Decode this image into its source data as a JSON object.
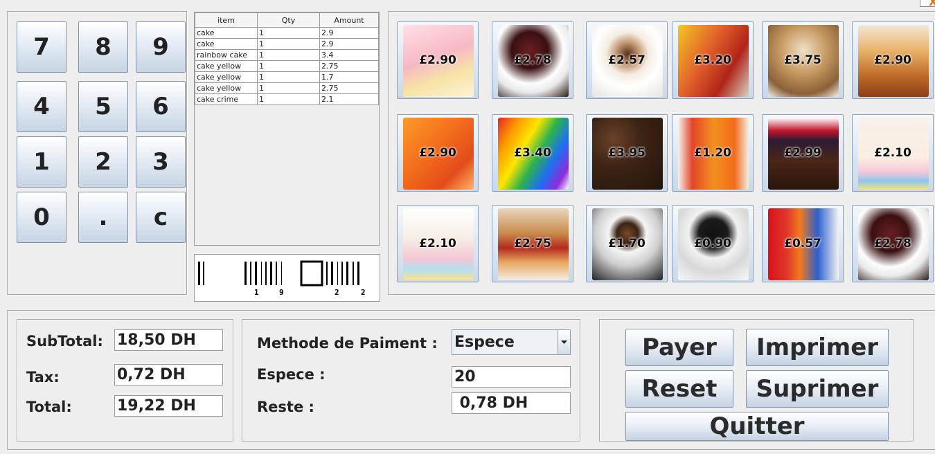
{
  "window": {
    "close_label": "X"
  },
  "keypad": {
    "keys": [
      "7",
      "8",
      "9",
      "4",
      "5",
      "6",
      "1",
      "2",
      "3",
      "0",
      ".",
      "c"
    ]
  },
  "order_table": {
    "headers": [
      "item",
      "Qty",
      "Amount"
    ],
    "rows": [
      [
        "cake",
        "1",
        "2.9"
      ],
      [
        "cake",
        "1",
        "2.9"
      ],
      [
        "rainbow cake",
        "1",
        "3.4"
      ],
      [
        "cake yellow",
        "1",
        "2.75"
      ],
      [
        "cake yellow",
        "1",
        "1.7"
      ],
      [
        "cake yellow",
        "1",
        "2.75"
      ],
      [
        "cake crime",
        "1",
        "2.1"
      ]
    ]
  },
  "barcode": {
    "digits": [
      "1",
      "9",
      "2",
      "2"
    ]
  },
  "products": [
    {
      "price": "£2.90",
      "icon": "strawberry-cake-slice"
    },
    {
      "price": "£2.78",
      "icon": "chocolate-cake"
    },
    {
      "price": "£2.57",
      "icon": "cappuccino"
    },
    {
      "price": "£3.20",
      "icon": "iced-fruit-drinks"
    },
    {
      "price": "£3.75",
      "icon": "iced-coffee"
    },
    {
      "price": "£2.90",
      "icon": "sponge-cake"
    },
    {
      "price": "£2.90",
      "icon": "orange-juice"
    },
    {
      "price": "£3.40",
      "icon": "rainbow-cake"
    },
    {
      "price": "£3.95",
      "icon": "coffee-beans"
    },
    {
      "price": "£1.20",
      "icon": "orange-juice-glasses"
    },
    {
      "price": "£2.99",
      "icon": "berry-chocolate-cake"
    },
    {
      "price": "£2.10",
      "icon": "sprinkle-cake"
    },
    {
      "price": "£2.10",
      "icon": "sprinkle-cake-slice"
    },
    {
      "price": "£2.75",
      "icon": "victoria-sponge"
    },
    {
      "price": "£1.70",
      "icon": "espresso-cup"
    },
    {
      "price": "£0.90",
      "icon": "black-coffee"
    },
    {
      "price": "£0.57",
      "icon": "soda-cans"
    },
    {
      "price": "£2.78",
      "icon": "chocolate-cake"
    }
  ],
  "totals": {
    "subtotal_label": "SubTotal:",
    "subtotal_value": "18,50 DH",
    "tax_label": "Tax:",
    "tax_value": "0,72 DH",
    "total_label": "Total:",
    "total_value": "19,22 DH"
  },
  "payment": {
    "method_label": "Methode de Paiment :",
    "method_value": "Espece",
    "cash_label": "Espece :",
    "cash_value": "20",
    "change_label": "Reste :",
    "change_value": " 0,78 DH"
  },
  "actions": {
    "pay": "Payer",
    "print": "Imprimer",
    "reset": "Reset",
    "delete": "Suprimer",
    "quit": "Quitter"
  },
  "colors": {
    "button_top": "#ffffff",
    "button_bottom": "#c4d3e3",
    "border": "#7d93ad",
    "close_x": "#e8730c"
  }
}
